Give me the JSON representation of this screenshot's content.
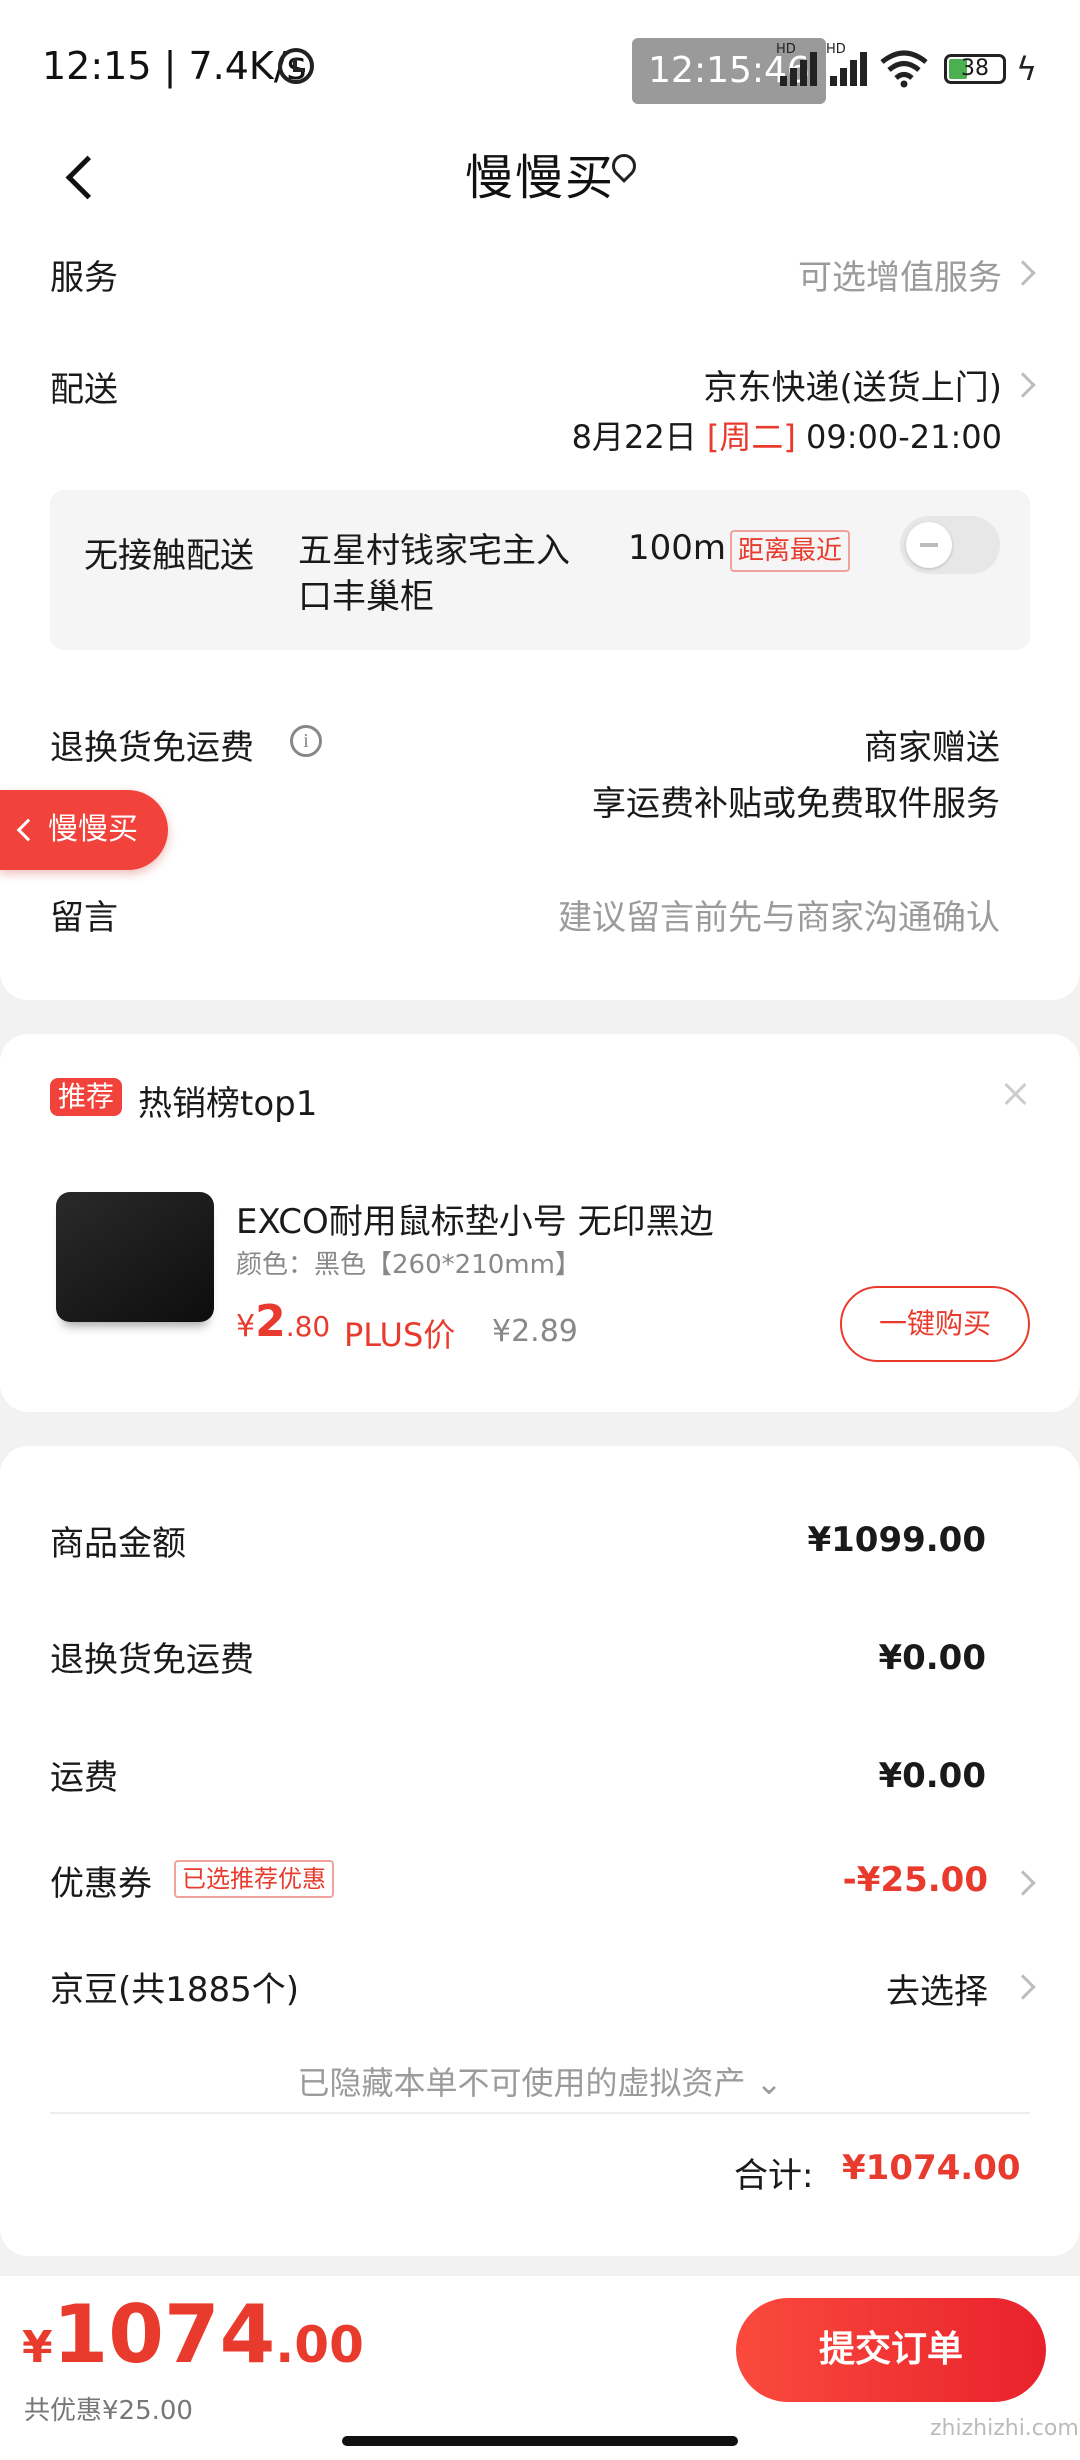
{
  "status_bar": {
    "time": "12:15",
    "net_speed": "| 7.4K/s",
    "overlay_time": "12:15:46",
    "battery": "38",
    "hd1": "HD",
    "hd2": "HD"
  },
  "header": {
    "title": "慢慢买"
  },
  "service_row": {
    "label": "服务",
    "value": "可选增值服务"
  },
  "delivery_row": {
    "label": "配送",
    "value": "京东快递(送货上门)",
    "date": "8月22日",
    "weekday": "[周二]",
    "time_range": "09:00-21:00"
  },
  "contactless": {
    "label": "无接触配送",
    "location": "五星村钱家宅主入口丰巢柜",
    "distance": "100m",
    "badge": "距离最近"
  },
  "return_row": {
    "label": "退换货免运费",
    "value": "商家赠送",
    "sub": "享运费补贴或免费取件服务"
  },
  "float_tab": {
    "label": "慢慢买"
  },
  "message_row": {
    "label": "留言",
    "placeholder": "建议留言前先与商家沟通确认"
  },
  "recommend": {
    "badge": "推荐",
    "title": "热销榜top1",
    "product_name": "EXCO耐用鼠标垫小号 无印黑边",
    "spec": "颜色：黑色【260*210mm】",
    "price_currency": "¥",
    "price_int": "2",
    "price_dec": ".80",
    "plus_label": "PLUS价",
    "orig_price": "¥2.89",
    "buy_label": "一键购买"
  },
  "amounts": {
    "goods_label": "商品金额",
    "goods_value": "¥1099.00",
    "return_label": "退换货免运费",
    "return_value": "¥0.00",
    "shipping_label": "运费",
    "shipping_value": "¥0.00",
    "coupon_label": "优惠券",
    "coupon_badge": "已选推荐优惠",
    "coupon_value": "-¥25.00",
    "jingdou_label": "京豆(共1885个)",
    "jingdou_value": "去选择",
    "hidden_note": "已隐藏本单不可使用的虚拟资产 ⌄",
    "total_label": "合计:",
    "total_value": "¥1074.00"
  },
  "bottom": {
    "currency": "¥",
    "price_int": "1074",
    "price_dec": ".00",
    "discount": "共优惠¥25.00",
    "submit": "提交订单",
    "watermark": "zhizhizhi.com"
  },
  "colors": {
    "accent_red": "#e93b2d",
    "background": "#f2f2f2"
  }
}
